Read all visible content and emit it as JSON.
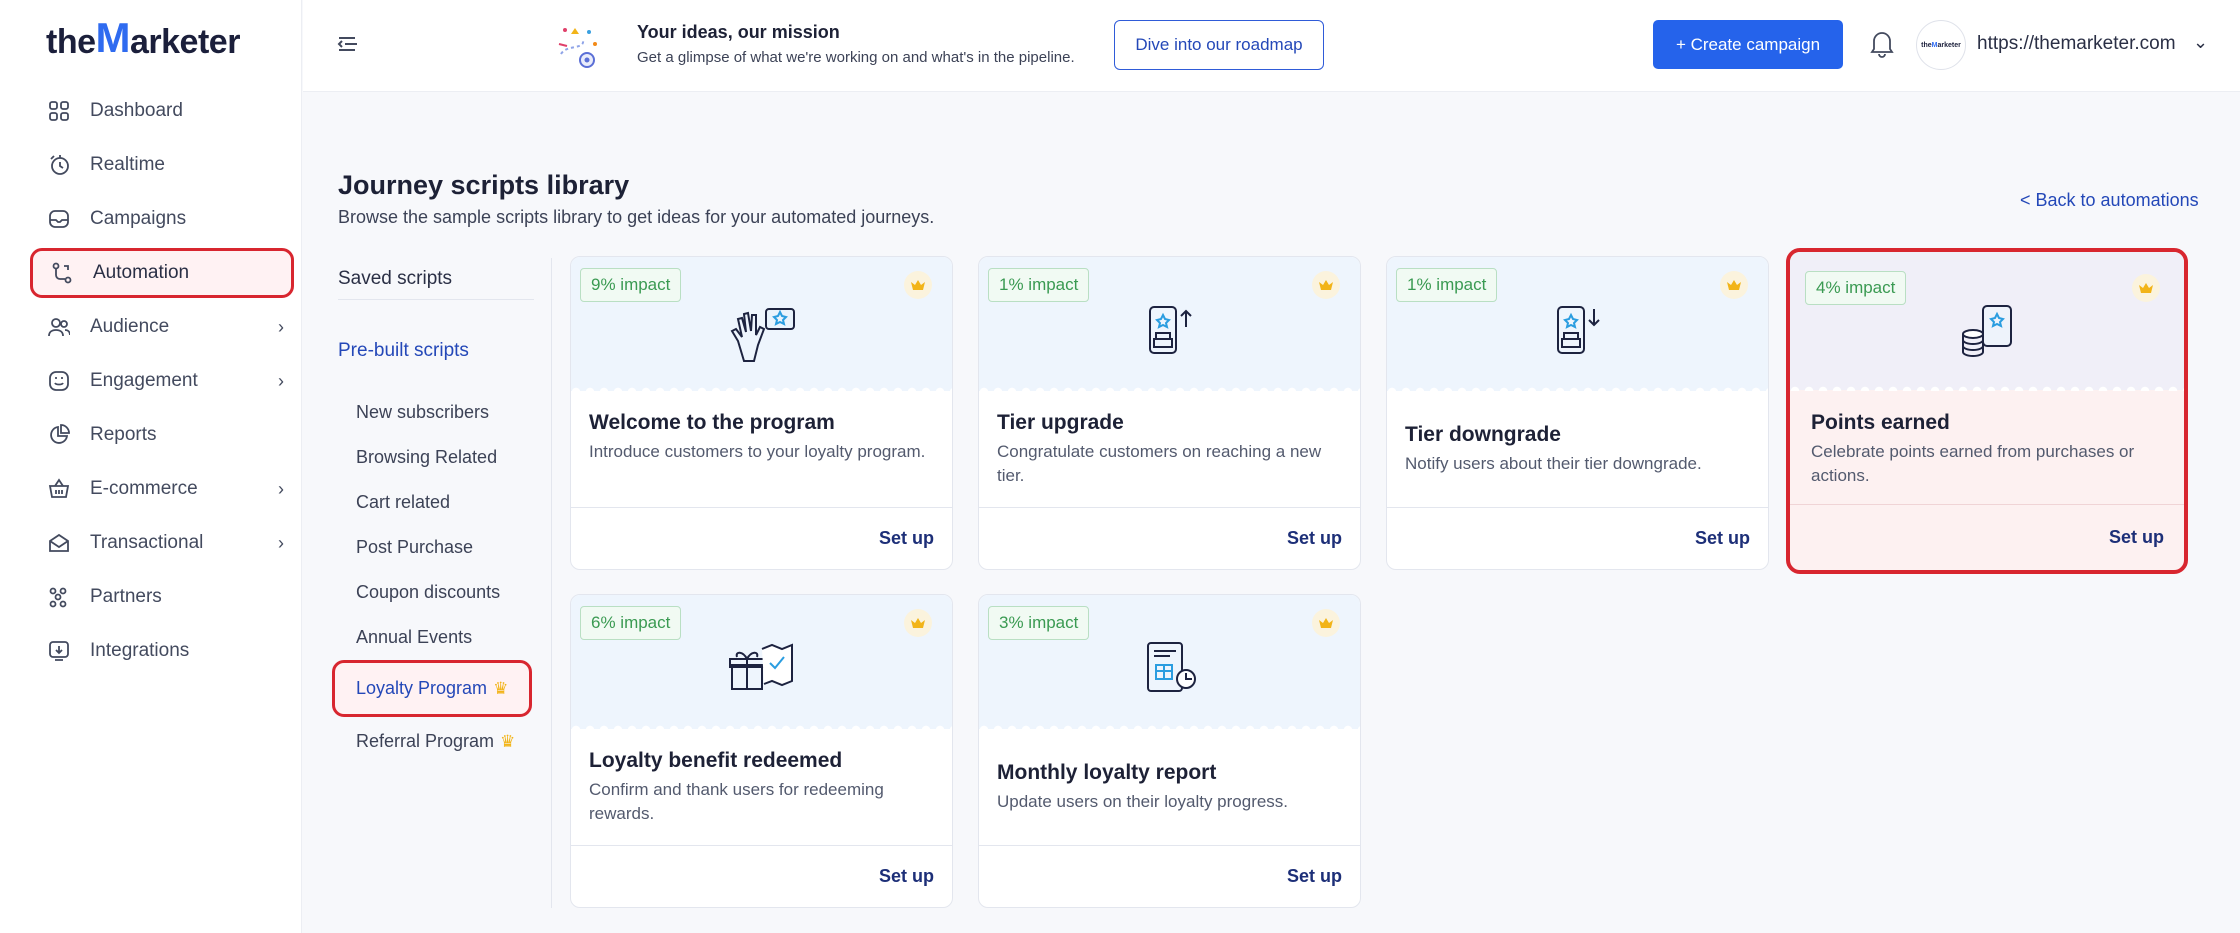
{
  "brand": {
    "logo_pre": "the",
    "logo_m": "M",
    "logo_post": "arketer"
  },
  "sidebar": {
    "items": [
      {
        "label": "Dashboard",
        "icon": "grid-icon"
      },
      {
        "label": "Realtime",
        "icon": "stopwatch-icon"
      },
      {
        "label": "Campaigns",
        "icon": "folder-icon"
      },
      {
        "label": "Automation",
        "icon": "flow-icon"
      },
      {
        "label": "Audience",
        "icon": "users-icon"
      },
      {
        "label": "Engagement",
        "icon": "smile-icon"
      },
      {
        "label": "Reports",
        "icon": "pie-icon"
      },
      {
        "label": "E-commerce",
        "icon": "basket-icon"
      },
      {
        "label": "Transactional",
        "icon": "envelope-icon"
      },
      {
        "label": "Partners",
        "icon": "partners-icon"
      },
      {
        "label": "Integrations",
        "icon": "plug-icon"
      }
    ]
  },
  "topbar": {
    "promo_title": "Your ideas, our mission",
    "promo_sub": "Get a glimpse of what we're working on and what's in the pipeline.",
    "roadmap_button": "Dive into our roadmap",
    "create_button": "+ Create campaign",
    "site_url": "https://themarketer.com"
  },
  "page": {
    "title": "Journey scripts library",
    "subtitle": "Browse the sample scripts library to get ideas for your automated journeys.",
    "back_link": "< Back to automations"
  },
  "scripts_nav": {
    "saved": "Saved scripts",
    "prebuilt": "Pre-built scripts",
    "categories": [
      "New subscribers",
      "Browsing Related",
      "Cart related",
      "Post Purchase",
      "Coupon discounts",
      "Annual Events",
      "Loyalty Program",
      "Referral Program"
    ]
  },
  "cards": [
    {
      "impact": "9% impact",
      "title": "Welcome to the program",
      "desc": "Introduce customers to your loyalty program.",
      "action": "Set up"
    },
    {
      "impact": "1% impact",
      "title": "Tier upgrade",
      "desc": "Congratulate customers on reaching a new tier.",
      "action": "Set up"
    },
    {
      "impact": "1% impact",
      "title": "Tier downgrade",
      "desc": "Notify users about their tier downgrade.",
      "action": "Set up"
    },
    {
      "impact": "4% impact",
      "title": "Points earned",
      "desc": "Celebrate points earned from purchases or actions.",
      "action": "Set up"
    },
    {
      "impact": "6% impact",
      "title": "Loyalty benefit redeemed",
      "desc": "Confirm and thank users for redeeming rewards.",
      "action": "Set up"
    },
    {
      "impact": "3% impact",
      "title": "Monthly loyalty report",
      "desc": "Update users on their loyalty progress.",
      "action": "Set up"
    }
  ],
  "colors": {
    "accent": "#2563eb",
    "highlight": "#d8262f",
    "impact_green": "#3a9a52",
    "crown": "#f2b418"
  }
}
